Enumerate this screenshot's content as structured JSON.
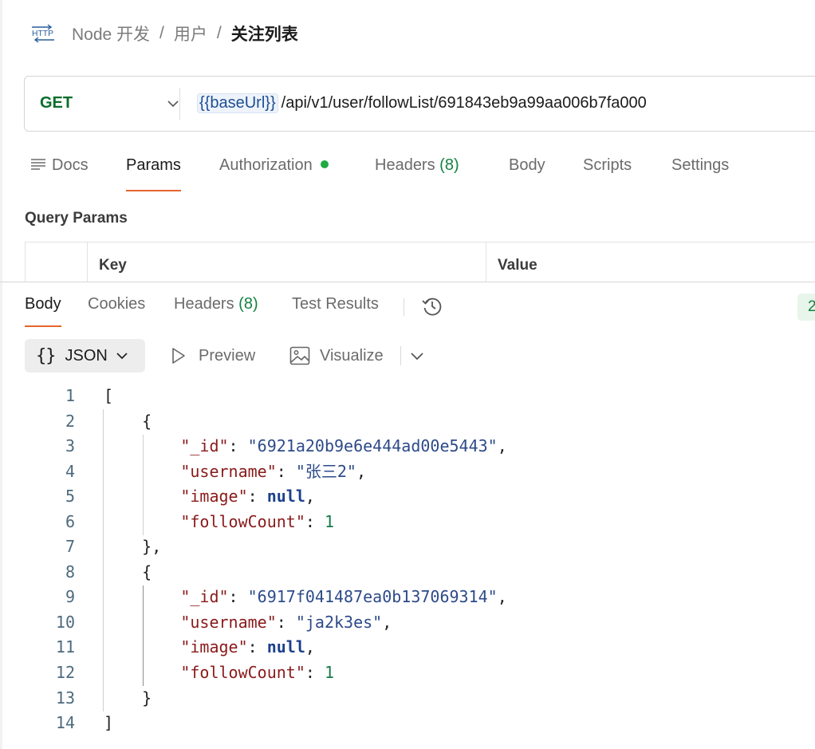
{
  "breadcrumb": {
    "icon_label": "HTTP",
    "items": [
      "Node 开发",
      "用户"
    ],
    "separator": "/",
    "current": "关注列表"
  },
  "request": {
    "method": "GET",
    "url_variable": "{{baseUrl}}",
    "url_path": "/api/v1/user/followList/691843eb9a99aa006b7fa000"
  },
  "request_tabs": [
    {
      "label": "Docs"
    },
    {
      "label": "Params"
    },
    {
      "label": "Authorization"
    },
    {
      "label": "Headers",
      "count": "(8)"
    },
    {
      "label": "Body"
    },
    {
      "label": "Scripts"
    },
    {
      "label": "Settings"
    }
  ],
  "active_request_tab": "Params",
  "query_params": {
    "title": "Query Params",
    "columns": [
      "Key",
      "Value"
    ]
  },
  "response_tabs": [
    {
      "label": "Body"
    },
    {
      "label": "Cookies"
    },
    {
      "label": "Headers",
      "count": "(8)"
    },
    {
      "label": "Test Results"
    }
  ],
  "active_response_tab": "Body",
  "status_badge": "2",
  "response_toolbar": {
    "format_braces": "{}",
    "format": "JSON",
    "preview": "Preview",
    "visualize": "Visualize"
  },
  "colors": {
    "accent": "#e5642c",
    "method_get": "#0b6e2c",
    "auth_dot": "#1faa43",
    "json_key": "#8a1a1a",
    "json_string": "#2d4a8a",
    "json_number": "#177a4d"
  },
  "response_body": [
    {
      "n": "1",
      "tokens": [
        {
          "t": "p",
          "v": "["
        }
      ]
    },
    {
      "n": "2",
      "tokens": [
        {
          "t": "p",
          "v": "    {"
        }
      ]
    },
    {
      "n": "3",
      "tokens": [
        {
          "t": "p",
          "v": "        "
        },
        {
          "t": "k",
          "v": "\"_id\""
        },
        {
          "t": "p",
          "v": ": "
        },
        {
          "t": "s",
          "v": "\"6921a20b9e6e444ad00e5443\""
        },
        {
          "t": "p",
          "v": ","
        }
      ]
    },
    {
      "n": "4",
      "tokens": [
        {
          "t": "p",
          "v": "        "
        },
        {
          "t": "k",
          "v": "\"username\""
        },
        {
          "t": "p",
          "v": ": "
        },
        {
          "t": "s",
          "v": "\"张三2\""
        },
        {
          "t": "p",
          "v": ","
        }
      ]
    },
    {
      "n": "5",
      "tokens": [
        {
          "t": "p",
          "v": "        "
        },
        {
          "t": "k",
          "v": "\"image\""
        },
        {
          "t": "p",
          "v": ": "
        },
        {
          "t": "w",
          "v": "null"
        },
        {
          "t": "p",
          "v": ","
        }
      ]
    },
    {
      "n": "6",
      "tokens": [
        {
          "t": "p",
          "v": "        "
        },
        {
          "t": "k",
          "v": "\"followCount\""
        },
        {
          "t": "p",
          "v": ": "
        },
        {
          "t": "d",
          "v": "1"
        }
      ]
    },
    {
      "n": "7",
      "tokens": [
        {
          "t": "p",
          "v": "    },"
        }
      ]
    },
    {
      "n": "8",
      "tokens": [
        {
          "t": "p",
          "v": "    {"
        }
      ]
    },
    {
      "n": "9",
      "tokens": [
        {
          "t": "p",
          "v": "        "
        },
        {
          "t": "k",
          "v": "\"_id\""
        },
        {
          "t": "p",
          "v": ": "
        },
        {
          "t": "s",
          "v": "\"6917f041487ea0b137069314\""
        },
        {
          "t": "p",
          "v": ","
        }
      ]
    },
    {
      "n": "10",
      "tokens": [
        {
          "t": "p",
          "v": "        "
        },
        {
          "t": "k",
          "v": "\"username\""
        },
        {
          "t": "p",
          "v": ": "
        },
        {
          "t": "s",
          "v": "\"ja2k3es\""
        },
        {
          "t": "p",
          "v": ","
        }
      ]
    },
    {
      "n": "11",
      "tokens": [
        {
          "t": "p",
          "v": "        "
        },
        {
          "t": "k",
          "v": "\"image\""
        },
        {
          "t": "p",
          "v": ": "
        },
        {
          "t": "w",
          "v": "null"
        },
        {
          "t": "p",
          "v": ","
        }
      ]
    },
    {
      "n": "12",
      "tokens": [
        {
          "t": "p",
          "v": "        "
        },
        {
          "t": "k",
          "v": "\"followCount\""
        },
        {
          "t": "p",
          "v": ": "
        },
        {
          "t": "d",
          "v": "1"
        }
      ]
    },
    {
      "n": "13",
      "tokens": [
        {
          "t": "p",
          "v": "    }"
        }
      ]
    },
    {
      "n": "14",
      "tokens": [
        {
          "t": "p",
          "v": "]"
        }
      ]
    }
  ]
}
